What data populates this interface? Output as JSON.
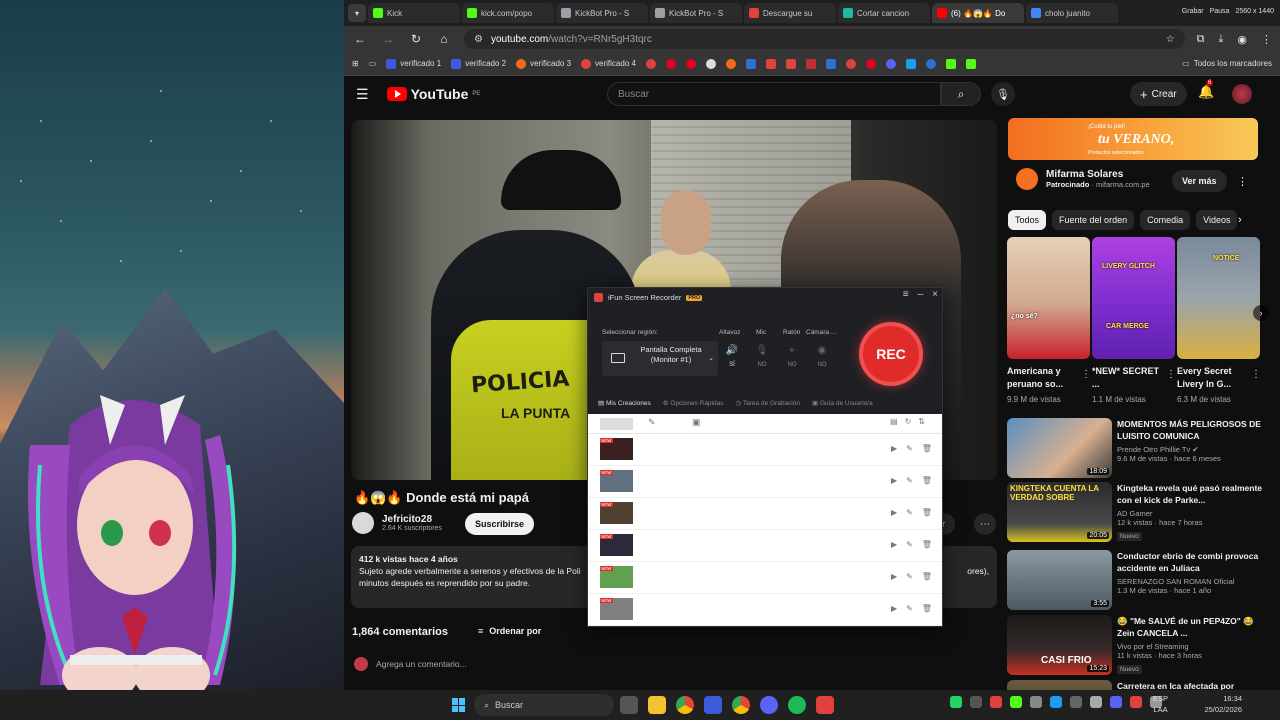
{
  "tabs": [
    {
      "label": "Kick",
      "color": "#53fc18"
    },
    {
      "label": "kick.com/popo",
      "color": "#53fc18"
    },
    {
      "label": "KickBot Pro - S",
      "color": "#9aa0a6"
    },
    {
      "label": "KickBot Pro - S",
      "color": "#9aa0a6"
    },
    {
      "label": "Descargue su",
      "color": "#e2423e"
    },
    {
      "label": "Cortar cancion",
      "color": "#1db9a0"
    },
    {
      "label": "(6) 🔥😱🔥 Do",
      "color": "#ff0000",
      "active": true
    },
    {
      "label": "cholo juanito",
      "color": "#4285f4"
    }
  ],
  "rec_strip": [
    "Grabar",
    "Pausa",
    "2560 x 1440"
  ],
  "address": {
    "host": "youtube.com",
    "path": "/watch?v=RNr5gH3tqrc"
  },
  "bookmarks": [
    "verificado 1",
    "verificado 2",
    "verificado 3",
    "verificado 4"
  ],
  "bookmarks_right": "Todos los marcadores",
  "yt": {
    "logo": "YouTube",
    "logo_sup": "PE",
    "search_placeholder": "Buscar",
    "create": "Crear",
    "notif_count": "6"
  },
  "video": {
    "title": "🔥😱🔥 Donde está mi papá",
    "overlay_police": "POLICIA",
    "overlay_police2": "LA PUNTA",
    "channel": "Jefricito28",
    "subs": "2.64 K suscriptores",
    "subscribe": "Suscribirse",
    "share": "dar",
    "meta": "412 k vistas  hace 4 años",
    "desc1": "Sujeto agrede verbalmente a serenos y efectivos de la Poli",
    "desc1_tail": "ores),",
    "desc2": "minutos después es reprendido por su padre.",
    "comments": "1,864 comentarios",
    "sort": "Ordenar por",
    "add_comment": "Agrega un comentario..."
  },
  "ad": {
    "tag": "¡Cuidá tu piel!",
    "big": "tu VERANO,",
    "fine": "Productos seleccionados",
    "title": "Mifarma Solares",
    "sponsored": "Patrocinado",
    "domain": "mifarma.com.pe",
    "cta": "Ver más"
  },
  "chips": [
    "Todos",
    "Fuente del orden",
    "Comedia",
    "Videos"
  ],
  "shorts": [
    {
      "title": "Americana y peruano so...",
      "views": "9.9 M de vistas",
      "overlay": "¿no sé?",
      "colors": [
        "#e8d0b8",
        "#c8202a"
      ]
    },
    {
      "title": "*NEW* SECRET ...",
      "views": "1.1 M de vistas",
      "overlay": "LIVERY GLITCH",
      "overlay2": "CAR MERGE",
      "colors": [
        "#b040e0",
        "#6020b0"
      ]
    },
    {
      "title": "Every Secret Livery In G...",
      "views": "6.3 M de vistas",
      "overlay": "NOTICE",
      "colors": [
        "#7a8a9a",
        "#d8b040"
      ]
    }
  ],
  "recs": [
    {
      "title": "MOMENTOS MÁS PELIGROSOS DE LUISITO COMUNICA",
      "channel": "Prende Otro Phillie Tv ✔",
      "meta": "9.6 M de vistas · hace 6 meses",
      "badge": "",
      "dur": "18:09",
      "colors": [
        "#5a8fc0",
        "#d8b090"
      ]
    },
    {
      "title": "Kingteka revela qué pasó realmente con el kick de Parke...",
      "channel": "AD Gamer",
      "meta": "12 k vistas · hace 7 horas",
      "badge": "Nuevo",
      "dur": "20:05",
      "overlay": "KINGTEKA CUENTA LA VERDAD SOBRE",
      "colors": [
        "#2a2a2a",
        "#d8c020"
      ]
    },
    {
      "title": "Conductor ebrio de combi provoca accidente en Juliaca",
      "channel": "SERENAZGO SAN ROMAN Oficial",
      "meta": "1.3 M de vistas · hace 1 año",
      "badge": "",
      "dur": "3:55",
      "colors": [
        "#8a9aa0",
        "#4a5a60"
      ]
    },
    {
      "title": "😂 \"Me SALVÉ de un PEP4ZO\" 😂 Zein CANCELA ...",
      "channel": "Vivo por el Streaming",
      "meta": "11 k vistas · hace 3 horas",
      "badge": "Nuevo",
      "dur": "15:23",
      "overlay": "CASI FRIO",
      "colors": [
        "#1a1a1a",
        "#c83020"
      ]
    },
    {
      "title": "Carretera en Ica afectada por",
      "channel": "",
      "meta": "",
      "badge": "",
      "dur": "",
      "colors": [
        "#6a5a40",
        "#3a3020"
      ]
    }
  ],
  "ifun": {
    "title": "iFun Screen Recorder",
    "pro": "PRO",
    "select_region": "Seleccionar región:",
    "region_value": "Pantalla Completa (Monitor #1)",
    "sources": [
      {
        "label": "Altavoz",
        "state": "SÍ"
      },
      {
        "label": "Mic",
        "state": "NO"
      },
      {
        "label": "Ratón",
        "state": "NO"
      },
      {
        "label": "Cámara ...",
        "state": "NO"
      }
    ],
    "rec": "REC",
    "tabs": [
      "Mis Creaciones",
      "Opciones Rápidas",
      "Tarea de Grabación",
      "Guía de Usuario/a"
    ],
    "new_tag": "NEW",
    "row_colors": [
      "#3a2020",
      "#607080",
      "#504030",
      "#2a2a3a",
      "#60a050",
      "#808080"
    ]
  },
  "taskbar": {
    "search": "Buscar",
    "lang1": "ESP",
    "lang2": "LAA",
    "time": "16:34",
    "date": "25/02/2026"
  }
}
